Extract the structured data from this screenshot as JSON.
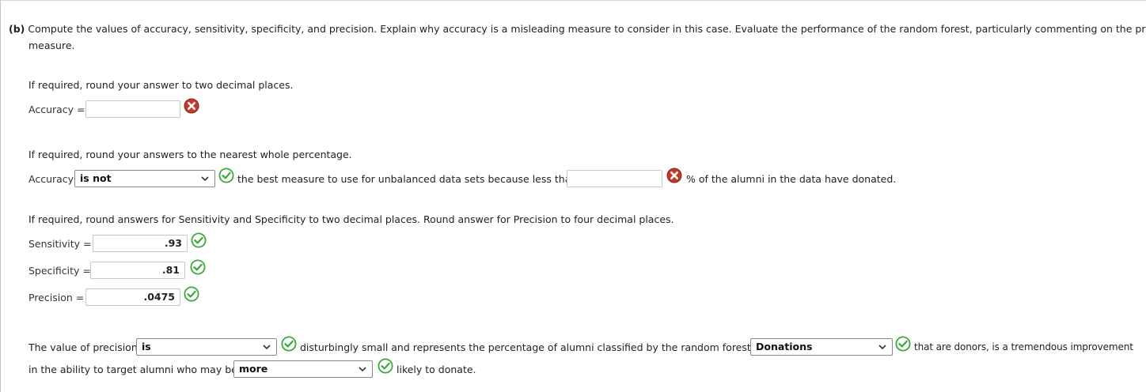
{
  "question": {
    "part": "(b)",
    "text_line1": "Compute the values of accuracy, sensitivity, specificity, and precision. Explain why accuracy is a misleading measure to consider in this case. Evaluate the performance of the random forest, particularly commenting on the precision",
    "text_line2": "measure."
  },
  "section1": {
    "instruction": "If required, round your answer to two decimal places.",
    "accuracy_label": "Accuracy =",
    "accuracy_value": "",
    "accuracy_status": "incorrect-icon"
  },
  "section2": {
    "instruction": "If required, round your answers to the nearest whole percentage.",
    "accuracy_label": "Accuracy",
    "select_value": "is not",
    "select_status": "correct-icon",
    "text_middle": "the best measure to use for unbalanced data sets because less than",
    "percent_value": "",
    "percent_status": "incorrect-icon",
    "text_end": "% of the alumni in the data have donated."
  },
  "section3": {
    "instruction": "If required, round answers for Sensitivity and Specificity to two decimal places. Round answer for Precision to four decimal places.",
    "sensitivity_label": "Sensitivity =",
    "sensitivity_value": ".93",
    "specificity_label": "Specificity =",
    "specificity_value": ".81",
    "precision_label": "Precision =",
    "precision_value": ".0475"
  },
  "section4": {
    "text_start": "The value of precision",
    "select1_value": "is",
    "text_mid1": "disturbingly small and represents the percentage of alumni classified by the random forest as",
    "select2_value": "Donations",
    "text_mid2": "that are donors, is a tremendous improvement",
    "text_line2_start": "in the ability to target alumni who may be",
    "select3_value": "more",
    "text_line2_end": "likely to donate."
  },
  "colors": {
    "correct": "#3aa83a",
    "incorrect": "#c0392b"
  }
}
